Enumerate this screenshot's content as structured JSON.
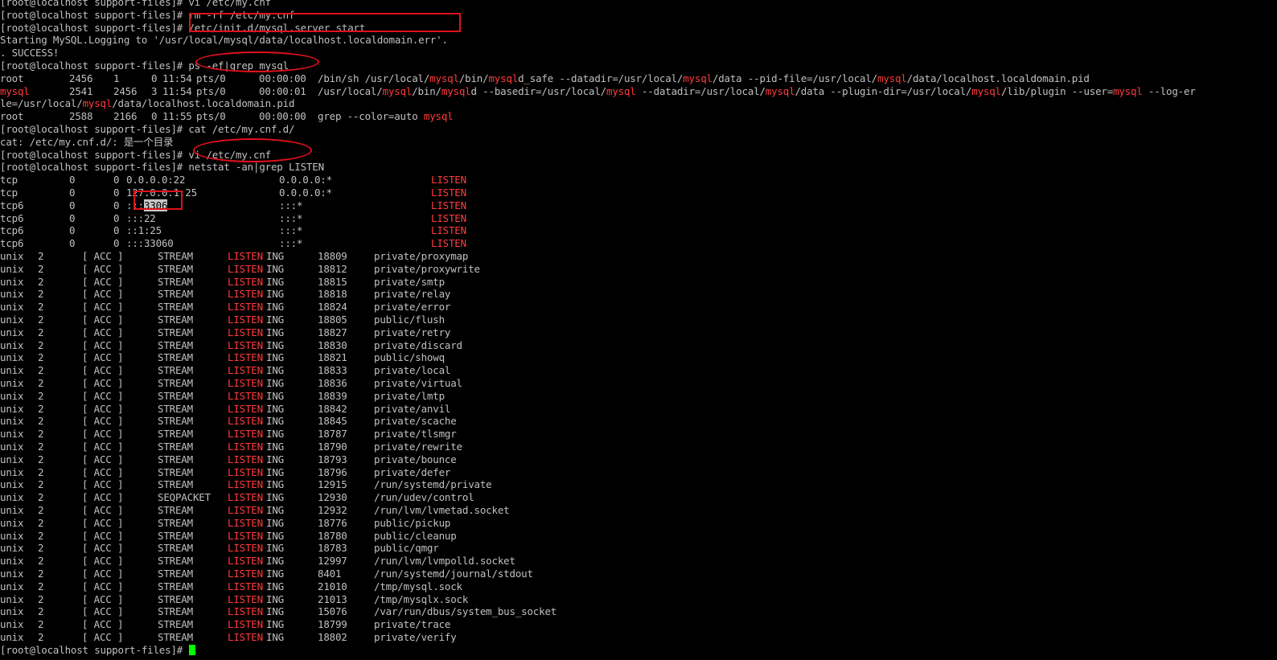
{
  "terminal": {
    "prompt": "[root@localhost support-files]# ",
    "lines_top": [
      "[root@localhost support-files]# vi /etc/my.cnf",
      "[root@localhost support-files]# rm -rf /etc/my.cnf",
      "[root@localhost support-files]# /etc/init.d/mysql.server start",
      "Starting MySQL.Logging to '/usr/local/mysql/data/localhost.localdomain.err'.",
      ". SUCCESS!",
      "[root@localhost support-files]# ps -ef|grep mysql"
    ],
    "ps_rows": [
      {
        "user": "root",
        "pid": "2456",
        "ppid": "1",
        "c": "0",
        "stime": "11:54",
        "tty": "pts/0",
        "time": "00:00:00",
        "cmd": "/bin/sh /usr/local/mysql/bin/mysqld_safe --datadir=/usr/local/mysql/data --pid-file=/usr/local/mysql/data/localhost.localdomain.pid"
      },
      {
        "user": "mysql",
        "pid": "2541",
        "ppid": "2456",
        "c": "3",
        "stime": "11:54",
        "tty": "pts/0",
        "time": "00:00:01",
        "cmd": "/usr/local/mysql/bin/mysqld --basedir=/usr/local/mysql --datadir=/usr/local/mysql/data --plugin-dir=/usr/local/mysql/lib/plugin --user=mysql --log-er"
      },
      {
        "user": "root",
        "pid": "2588",
        "ppid": "2166",
        "c": "0",
        "stime": "11:55",
        "tty": "pts/0",
        "time": "00:00:00",
        "cmd": "grep --color=auto mysql"
      }
    ],
    "ps_wrap": "le=/usr/local/mysql/data/localhost.localdomain.pid",
    "lines_mid": [
      "[root@localhost support-files]# cat /etc/my.cnf.d/",
      "cat: /etc/my.cnf.d/: 是一个目录",
      "[root@localhost support-files]# vi /etc/my.cnf",
      "[root@localhost support-files]# netstat -an|grep LISTEN"
    ],
    "tcp_rows": [
      {
        "proto": "tcp",
        "recvq": "0",
        "sendq": "0",
        "local": "0.0.0.0:22",
        "foreign": "0.0.0.0:*",
        "state": "LISTEN"
      },
      {
        "proto": "tcp",
        "recvq": "0",
        "sendq": "0",
        "local": "127.0.0.1:25",
        "foreign": "0.0.0.0:*",
        "state": "LISTEN"
      },
      {
        "proto": "tcp6",
        "recvq": "0",
        "sendq": "0",
        "local": ":::3306",
        "foreign": ":::*",
        "state": "LISTEN"
      },
      {
        "proto": "tcp6",
        "recvq": "0",
        "sendq": "0",
        "local": ":::22",
        "foreign": ":::*",
        "state": "LISTEN"
      },
      {
        "proto": "tcp6",
        "recvq": "0",
        "sendq": "0",
        "local": "::1:25",
        "foreign": ":::*",
        "state": "LISTEN"
      },
      {
        "proto": "tcp6",
        "recvq": "0",
        "sendq": "0",
        "local": ":::33060",
        "foreign": ":::*",
        "state": "LISTEN"
      }
    ],
    "unix_rows": [
      {
        "proto": "unix",
        "refcnt": "2",
        "flags": "[ ACC ]",
        "type": "STREAM",
        "state_hl": "LISTEN",
        "state_rest": "ING",
        "inode": "18809",
        "path": "private/proxymap"
      },
      {
        "proto": "unix",
        "refcnt": "2",
        "flags": "[ ACC ]",
        "type": "STREAM",
        "state_hl": "LISTEN",
        "state_rest": "ING",
        "inode": "18812",
        "path": "private/proxywrite"
      },
      {
        "proto": "unix",
        "refcnt": "2",
        "flags": "[ ACC ]",
        "type": "STREAM",
        "state_hl": "LISTEN",
        "state_rest": "ING",
        "inode": "18815",
        "path": "private/smtp"
      },
      {
        "proto": "unix",
        "refcnt": "2",
        "flags": "[ ACC ]",
        "type": "STREAM",
        "state_hl": "LISTEN",
        "state_rest": "ING",
        "inode": "18818",
        "path": "private/relay"
      },
      {
        "proto": "unix",
        "refcnt": "2",
        "flags": "[ ACC ]",
        "type": "STREAM",
        "state_hl": "LISTEN",
        "state_rest": "ING",
        "inode": "18824",
        "path": "private/error"
      },
      {
        "proto": "unix",
        "refcnt": "2",
        "flags": "[ ACC ]",
        "type": "STREAM",
        "state_hl": "LISTEN",
        "state_rest": "ING",
        "inode": "18805",
        "path": "public/flush"
      },
      {
        "proto": "unix",
        "refcnt": "2",
        "flags": "[ ACC ]",
        "type": "STREAM",
        "state_hl": "LISTEN",
        "state_rest": "ING",
        "inode": "18827",
        "path": "private/retry"
      },
      {
        "proto": "unix",
        "refcnt": "2",
        "flags": "[ ACC ]",
        "type": "STREAM",
        "state_hl": "LISTEN",
        "state_rest": "ING",
        "inode": "18830",
        "path": "private/discard"
      },
      {
        "proto": "unix",
        "refcnt": "2",
        "flags": "[ ACC ]",
        "type": "STREAM",
        "state_hl": "LISTEN",
        "state_rest": "ING",
        "inode": "18821",
        "path": "public/showq"
      },
      {
        "proto": "unix",
        "refcnt": "2",
        "flags": "[ ACC ]",
        "type": "STREAM",
        "state_hl": "LISTEN",
        "state_rest": "ING",
        "inode": "18833",
        "path": "private/local"
      },
      {
        "proto": "unix",
        "refcnt": "2",
        "flags": "[ ACC ]",
        "type": "STREAM",
        "state_hl": "LISTEN",
        "state_rest": "ING",
        "inode": "18836",
        "path": "private/virtual"
      },
      {
        "proto": "unix",
        "refcnt": "2",
        "flags": "[ ACC ]",
        "type": "STREAM",
        "state_hl": "LISTEN",
        "state_rest": "ING",
        "inode": "18839",
        "path": "private/lmtp"
      },
      {
        "proto": "unix",
        "refcnt": "2",
        "flags": "[ ACC ]",
        "type": "STREAM",
        "state_hl": "LISTEN",
        "state_rest": "ING",
        "inode": "18842",
        "path": "private/anvil"
      },
      {
        "proto": "unix",
        "refcnt": "2",
        "flags": "[ ACC ]",
        "type": "STREAM",
        "state_hl": "LISTEN",
        "state_rest": "ING",
        "inode": "18845",
        "path": "private/scache"
      },
      {
        "proto": "unix",
        "refcnt": "2",
        "flags": "[ ACC ]",
        "type": "STREAM",
        "state_hl": "LISTEN",
        "state_rest": "ING",
        "inode": "18787",
        "path": "private/tlsmgr"
      },
      {
        "proto": "unix",
        "refcnt": "2",
        "flags": "[ ACC ]",
        "type": "STREAM",
        "state_hl": "LISTEN",
        "state_rest": "ING",
        "inode": "18790",
        "path": "private/rewrite"
      },
      {
        "proto": "unix",
        "refcnt": "2",
        "flags": "[ ACC ]",
        "type": "STREAM",
        "state_hl": "LISTEN",
        "state_rest": "ING",
        "inode": "18793",
        "path": "private/bounce"
      },
      {
        "proto": "unix",
        "refcnt": "2",
        "flags": "[ ACC ]",
        "type": "STREAM",
        "state_hl": "LISTEN",
        "state_rest": "ING",
        "inode": "18796",
        "path": "private/defer"
      },
      {
        "proto": "unix",
        "refcnt": "2",
        "flags": "[ ACC ]",
        "type": "STREAM",
        "state_hl": "LISTEN",
        "state_rest": "ING",
        "inode": "12915",
        "path": "/run/systemd/private"
      },
      {
        "proto": "unix",
        "refcnt": "2",
        "flags": "[ ACC ]",
        "type": "SEQPACKET",
        "state_hl": "LISTEN",
        "state_rest": "ING",
        "inode": "12930",
        "path": "/run/udev/control"
      },
      {
        "proto": "unix",
        "refcnt": "2",
        "flags": "[ ACC ]",
        "type": "STREAM",
        "state_hl": "LISTEN",
        "state_rest": "ING",
        "inode": "12932",
        "path": "/run/lvm/lvmetad.socket"
      },
      {
        "proto": "unix",
        "refcnt": "2",
        "flags": "[ ACC ]",
        "type": "STREAM",
        "state_hl": "LISTEN",
        "state_rest": "ING",
        "inode": "18776",
        "path": "public/pickup"
      },
      {
        "proto": "unix",
        "refcnt": "2",
        "flags": "[ ACC ]",
        "type": "STREAM",
        "state_hl": "LISTEN",
        "state_rest": "ING",
        "inode": "18780",
        "path": "public/cleanup"
      },
      {
        "proto": "unix",
        "refcnt": "2",
        "flags": "[ ACC ]",
        "type": "STREAM",
        "state_hl": "LISTEN",
        "state_rest": "ING",
        "inode": "18783",
        "path": "public/qmgr"
      },
      {
        "proto": "unix",
        "refcnt": "2",
        "flags": "[ ACC ]",
        "type": "STREAM",
        "state_hl": "LISTEN",
        "state_rest": "ING",
        "inode": "12997",
        "path": "/run/lvm/lvmpolld.socket"
      },
      {
        "proto": "unix",
        "refcnt": "2",
        "flags": "[ ACC ]",
        "type": "STREAM",
        "state_hl": "LISTEN",
        "state_rest": "ING",
        "inode": "8401",
        "path": "/run/systemd/journal/stdout"
      },
      {
        "proto": "unix",
        "refcnt": "2",
        "flags": "[ ACC ]",
        "type": "STREAM",
        "state_hl": "LISTEN",
        "state_rest": "ING",
        "inode": "21010",
        "path": "/tmp/mysql.sock"
      },
      {
        "proto": "unix",
        "refcnt": "2",
        "flags": "[ ACC ]",
        "type": "STREAM",
        "state_hl": "LISTEN",
        "state_rest": "ING",
        "inode": "21013",
        "path": "/tmp/mysqlx.sock"
      },
      {
        "proto": "unix",
        "refcnt": "2",
        "flags": "[ ACC ]",
        "type": "STREAM",
        "state_hl": "LISTEN",
        "state_rest": "ING",
        "inode": "15076",
        "path": "/var/run/dbus/system_bus_socket"
      },
      {
        "proto": "unix",
        "refcnt": "2",
        "flags": "[ ACC ]",
        "type": "STREAM",
        "state_hl": "LISTEN",
        "state_rest": "ING",
        "inode": "18799",
        "path": "private/trace"
      },
      {
        "proto": "unix",
        "refcnt": "2",
        "flags": "[ ACC ]",
        "type": "STREAM",
        "state_hl": "LISTEN",
        "state_rest": "ING",
        "inode": "18802",
        "path": "private/verify"
      }
    ],
    "final_prompt": "[root@localhost support-files]# ",
    "highlight_word": "mysql"
  },
  "colors": {
    "background": "#000000",
    "text": "#c0c0c0",
    "highlight": "#ff3b3b",
    "cursor": "#00ff00",
    "annotation": "#e0111b"
  }
}
